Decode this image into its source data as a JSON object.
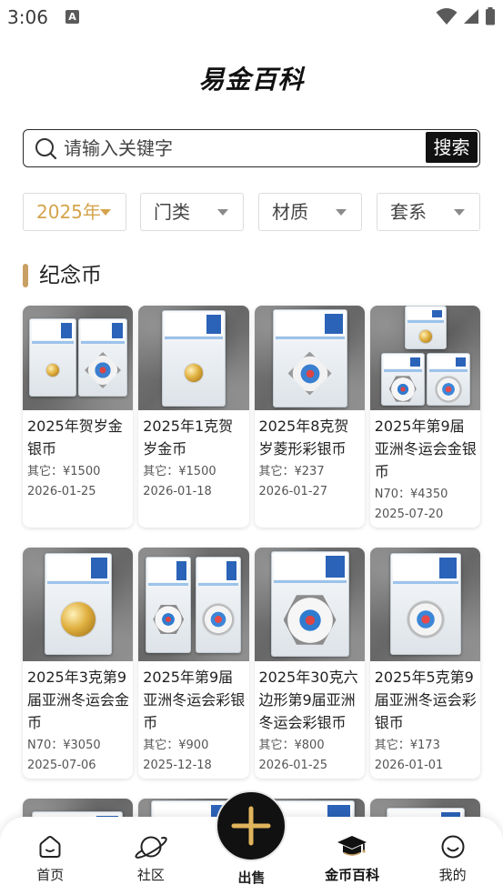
{
  "status_bar": {
    "time": "3:06",
    "notification_glyph": "A"
  },
  "header": {
    "logo": "易金百科"
  },
  "search": {
    "placeholder": "请输入关键字",
    "button_label": "搜索"
  },
  "filters": [
    {
      "label": "2025年",
      "selected": true
    },
    {
      "label": "门类",
      "selected": false
    },
    {
      "label": "材质",
      "selected": false
    },
    {
      "label": "套系",
      "selected": false
    }
  ],
  "section": {
    "title": "纪念币"
  },
  "items": [
    {
      "title": "2025年贺岁金银币",
      "price": "其它：¥1500",
      "date": "2026-01-25"
    },
    {
      "title": "2025年1克贺岁金币",
      "price": "其它：¥1500",
      "date": "2026-01-18"
    },
    {
      "title": "2025年8克贺岁菱形彩银币",
      "price": "其它：¥237",
      "date": "2026-01-27"
    },
    {
      "title": "2025年第9届亚洲冬运会金银币",
      "price": "N70：¥4350",
      "date": "2025-07-20"
    },
    {
      "title": "2025年3克第9届亚洲冬运会金币",
      "price": "N70：¥3050",
      "date": "2025-07-06"
    },
    {
      "title": "2025年第9届亚洲冬运会彩银币",
      "price": "其它：¥900",
      "date": "2025-12-18"
    },
    {
      "title": "2025年30克六边形第9届亚洲冬运会彩银币",
      "price": "其它：¥800",
      "date": "2026-01-25"
    },
    {
      "title": "2025年5克第9届亚洲冬运会彩银币",
      "price": "其它：¥173",
      "date": "2026-01-01"
    }
  ],
  "bottom_nav": [
    {
      "label": "首页",
      "icon": "home-icon",
      "active": false
    },
    {
      "label": "社区",
      "icon": "planet-icon",
      "active": false
    },
    {
      "label": "出售",
      "icon": "plus-icon",
      "active": false
    },
    {
      "label": "金币百科",
      "icon": "graduation-cap-icon",
      "active": true
    },
    {
      "label": "我的",
      "icon": "smile-icon",
      "active": false
    }
  ],
  "colors": {
    "accent": "#d4a44c",
    "section_bar": "#c9a063",
    "button_bg": "#111111",
    "plus_icon": "#e0b45c"
  }
}
